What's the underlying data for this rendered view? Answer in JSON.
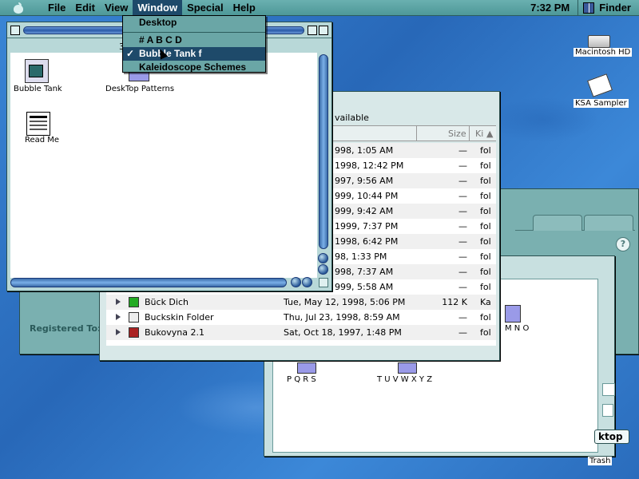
{
  "menubar": {
    "items": [
      "File",
      "Edit",
      "View",
      "Window",
      "Special",
      "Help"
    ],
    "clock": "7:32 PM",
    "app": "Finder"
  },
  "window_menu": {
    "items": [
      "Desktop",
      "# A B C D",
      "Bubble Tank f",
      "Kaleidoscope Schemes"
    ],
    "checked": "✓"
  },
  "front_window": {
    "title_partial": "3",
    "icons": [
      {
        "label": "Bubble Tank",
        "icon": "app-icon"
      },
      {
        "label": "DeskTop Patterns",
        "icon": "folder-icon"
      },
      {
        "label": "Read Me",
        "icon": "document-icon"
      }
    ]
  },
  "list_window": {
    "header_text": "vailable",
    "columns": {
      "size": "Size",
      "kind": "Ki"
    },
    "rows": [
      {
        "date": "998, 1:05 AM",
        "size": "—",
        "kind": "fol"
      },
      {
        "date": "1998, 12:42 PM",
        "size": "—",
        "kind": "fol"
      },
      {
        "date": "997, 9:56 AM",
        "size": "—",
        "kind": "fol"
      },
      {
        "date": "999, 10:44 PM",
        "size": "—",
        "kind": "fol"
      },
      {
        "date": "999, 9:42 AM",
        "size": "—",
        "kind": "fol"
      },
      {
        "date": "1999, 7:37 PM",
        "size": "—",
        "kind": "fol"
      },
      {
        "date": "1998, 6:42 PM",
        "size": "—",
        "kind": "fol"
      },
      {
        "date": "98, 1:33 PM",
        "size": "—",
        "kind": "fol"
      },
      {
        "date": "998, 7:37 AM",
        "size": "—",
        "kind": "fol"
      },
      {
        "date": "999, 5:58 AM",
        "size": "—",
        "kind": "fol"
      },
      {
        "name": "Bück Dich",
        "date": "Tue, May 12, 1998, 5:06 PM",
        "size": "112 K",
        "kind": "Ka"
      },
      {
        "name": "Buckskin Folder",
        "date": "Thu, Jul 23, 1998, 8:59 AM",
        "size": "—",
        "kind": "fol"
      },
      {
        "name": "Bukovyna 2.1",
        "date": "Sat, Oct 18, 1997, 1:48 PM",
        "size": "—",
        "kind": "fol"
      }
    ]
  },
  "back_window": {
    "registered_label": "Registered To:",
    "folders": [
      "M N O",
      "P Q R S",
      "T U V W X Y Z"
    ],
    "button_partial": "ktop"
  },
  "desktop_icons": [
    {
      "label": "Macintosh HD",
      "icon": "hard-drive-icon"
    },
    {
      "label": "KSA Sampler",
      "icon": "disk-icon"
    },
    {
      "label": "Trash",
      "icon": "trash-icon"
    }
  ],
  "colors": {
    "menu_highlight": "#1e4a6a",
    "platinum_teal": "#8cbcbc",
    "desktop": "#2a6fc0"
  }
}
